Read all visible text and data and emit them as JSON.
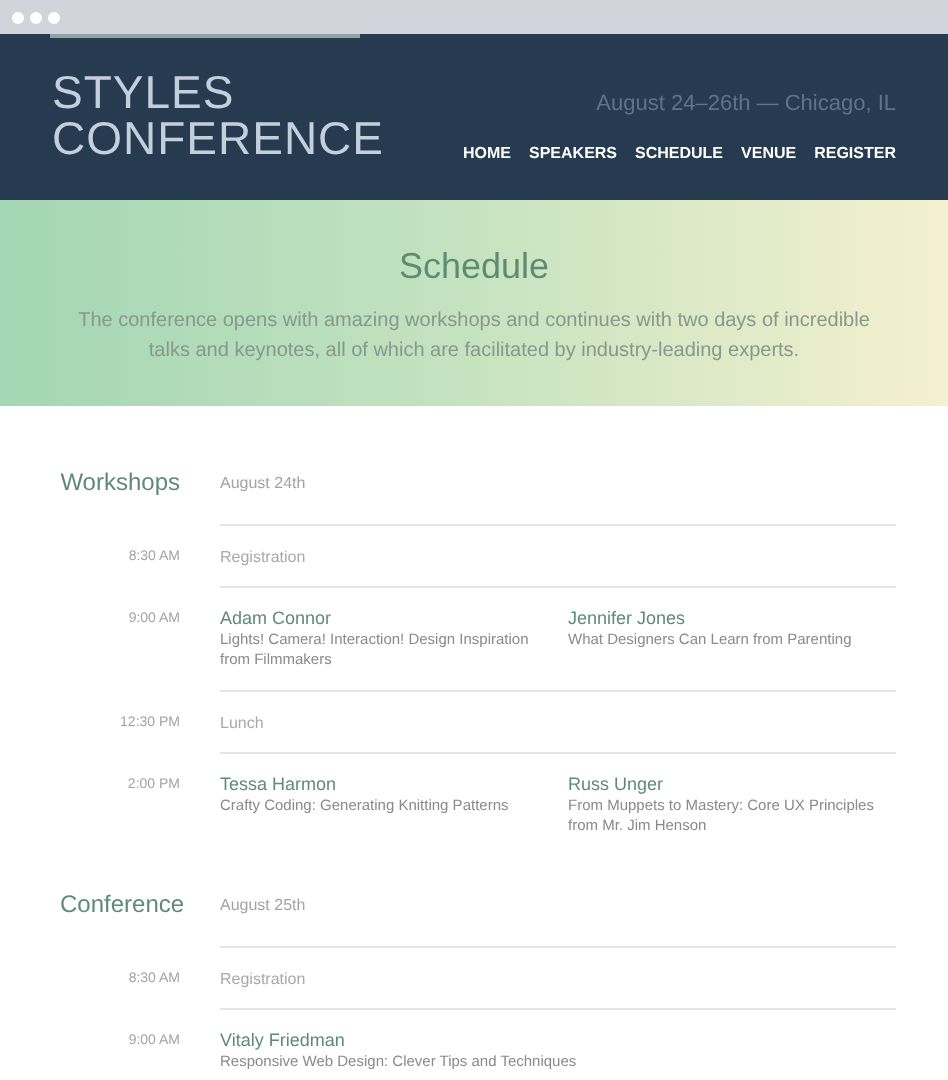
{
  "header": {
    "title_lines": [
      "STYLES",
      "CONFERENCE"
    ],
    "tagline": "August 24–26th — Chicago, IL",
    "nav": [
      {
        "label": "HOME"
      },
      {
        "label": "SPEAKERS"
      },
      {
        "label": "SCHEDULE"
      },
      {
        "label": "VENUE"
      },
      {
        "label": "REGISTER"
      }
    ]
  },
  "hero": {
    "title": "Schedule",
    "text": "The conference opens with amazing workshops and continues with two days of incredible talks and keynotes, all of which are facilitated by industry-leading experts."
  },
  "sections": [
    {
      "title": "Workshops",
      "date": "August 24th",
      "rows": [
        {
          "time": "8:30 AM",
          "kind": "note",
          "text": "Registration"
        },
        {
          "time": "9:00 AM",
          "kind": "talks",
          "talks": [
            {
              "speaker": "Adam Connor",
              "title": "Lights! Camera! Interaction! Design Inspiration from Filmmakers"
            },
            {
              "speaker": "Jennifer Jones",
              "title": "What Designers Can Learn from Parenting"
            }
          ]
        },
        {
          "time": "12:30 PM",
          "kind": "note",
          "text": "Lunch"
        },
        {
          "time": "2:00 PM",
          "kind": "talks",
          "talks": [
            {
              "speaker": "Tessa Harmon",
              "title": "Crafty Coding: Generating Knitting Patterns"
            },
            {
              "speaker": "Russ Unger",
              "title": "From Muppets to Mastery: Core UX Principles from Mr. Jim Henson"
            }
          ]
        }
      ]
    },
    {
      "title": "Conference",
      "date": "August 25th",
      "rows": [
        {
          "time": "8:30 AM",
          "kind": "note",
          "text": "Registration"
        },
        {
          "time": "9:00 AM",
          "kind": "talks",
          "talks": [
            {
              "speaker": "Vitaly Friedman",
              "title": "Responsive Web Design: Clever Tips and Techniques"
            }
          ]
        }
      ]
    }
  ]
}
